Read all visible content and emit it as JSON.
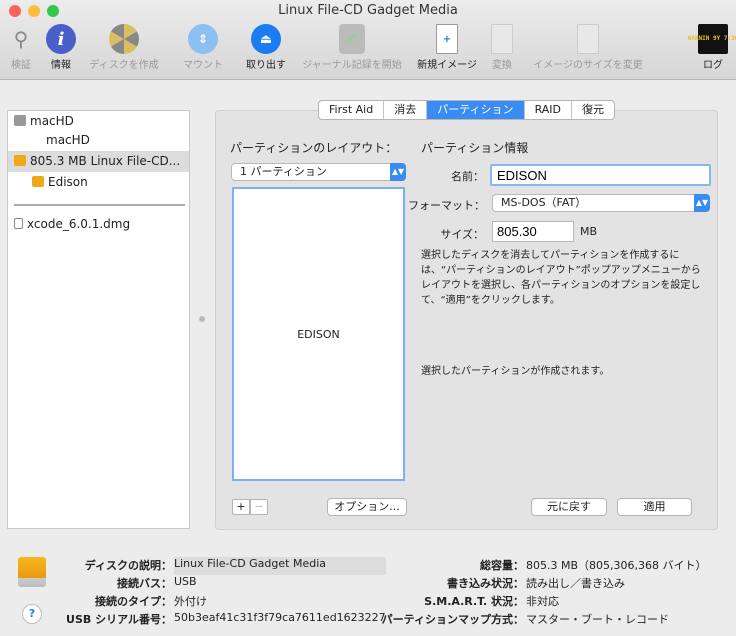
{
  "window": {
    "title": "Linux File-CD Gadget Media"
  },
  "toolbar": {
    "items": [
      {
        "label": "検証",
        "icon": "microscope-icon",
        "enabled": false
      },
      {
        "label": "情報",
        "icon": "info-icon",
        "enabled": true
      },
      {
        "label": "ディスクを作成",
        "icon": "burn-icon",
        "enabled": false
      },
      {
        "label": "マウント",
        "icon": "mount-icon",
        "enabled": false
      },
      {
        "label": "取り出す",
        "icon": "eject-icon",
        "enabled": true
      },
      {
        "label": "ジャーナル記録を開始",
        "icon": "journal-icon",
        "enabled": false
      },
      {
        "label": "新規イメージ",
        "icon": "new-image-icon",
        "enabled": true
      },
      {
        "label": "変換",
        "icon": "convert-icon",
        "enabled": false
      },
      {
        "label": "イメージのサイズを変更",
        "icon": "resize-image-icon",
        "enabled": false
      },
      {
        "label": "ログ",
        "icon": "log-icon",
        "enabled": true
      }
    ],
    "log_icon_text": "WARNIN 9Y 7:36"
  },
  "sidebar": {
    "items": [
      {
        "label": "macHD"
      },
      {
        "label": "macHD"
      },
      {
        "label": "805.3 MB Linux File-CD..."
      },
      {
        "label": "Edison"
      },
      {
        "label": "xcode_6.0.1.dmg"
      }
    ]
  },
  "tabs": [
    "First Aid",
    "消去",
    "パーティション",
    "RAID",
    "復元"
  ],
  "partition": {
    "layout_label": "パーティションのレイアウト：",
    "layout_value": "1 パーティション",
    "partition_block_name": "EDISON",
    "add": "+",
    "remove": "−",
    "options_button": "オプション...",
    "info_label": "パーティション情報",
    "name_label": "名前：",
    "name_value": "EDISON",
    "format_label": "フォーマット：",
    "format_value": "MS-DOS（FAT）",
    "size_label": "サイズ：",
    "size_value": "805.30",
    "size_unit": "MB",
    "description": "選択したディスクを消去してパーティションを作成するには、“パーティションのレイアウト”ポップアップメニューからレイアウトを選択し、各パーティションのオプションを設定して、“適用”をクリックします。",
    "status": "選択したパーティションが作成されます。",
    "revert_button": "元に戻す",
    "apply_button": "適用"
  },
  "info": {
    "left": [
      {
        "k": "ディスクの説明：",
        "v": "Linux File-CD Gadget Media"
      },
      {
        "k": "接続バス：",
        "v": "USB"
      },
      {
        "k": "接続のタイプ：",
        "v": "外付け"
      },
      {
        "k": "USB シリアル番号：",
        "v": "50b3eaf41c31f3f79ca7611ed1623227"
      }
    ],
    "right": [
      {
        "k": "総容量：",
        "v": "805.3 MB（805,306,368 バイト）"
      },
      {
        "k": "書き込み状況：",
        "v": "読み出し／書き込み"
      },
      {
        "k": "S.M.A.R.T. 状況：",
        "v": "非対応"
      },
      {
        "k": "パーティションマップ方式：",
        "v": "マスター・ブート・レコード"
      }
    ],
    "help": "?"
  },
  "colors": {
    "accent": "#3a8cf5",
    "disk_orange": "#f0a818"
  }
}
